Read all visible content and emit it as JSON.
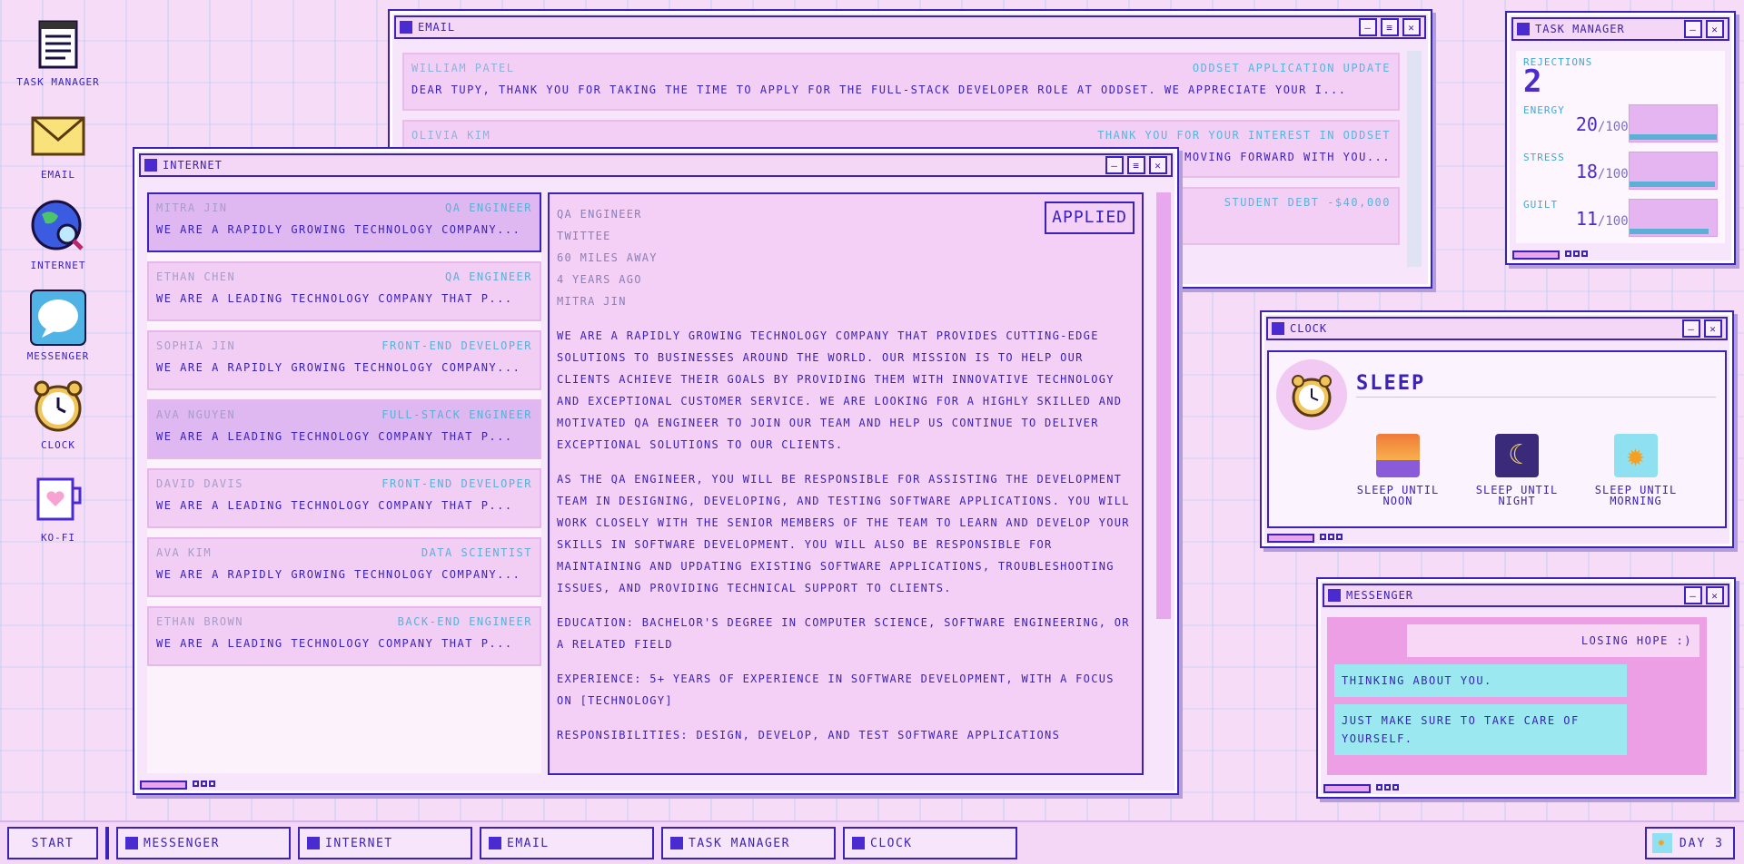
{
  "desktop": {
    "icons": [
      {
        "label": "Task Manager"
      },
      {
        "label": "Email"
      },
      {
        "label": "Internet"
      },
      {
        "label": "Messenger"
      },
      {
        "label": "Clock"
      },
      {
        "label": "Ko-fi"
      }
    ]
  },
  "email_window": {
    "title": "Email",
    "emails": [
      {
        "sender": "William Patel",
        "subject": "Oddset application update",
        "preview": "Dear Tupy, Thank you for taking the time to apply for the Full-Stack Developer role at Oddset. We appreciate your i..."
      },
      {
        "sender": "Olivia Kim",
        "subject": "Thank you for your interest in Oddset",
        "preview": "... moving forward with you..."
      },
      {
        "sender": "",
        "subject": "Student debt -$40,000",
        "preview": ""
      }
    ]
  },
  "internet_window": {
    "title": "Internet",
    "jobs": [
      {
        "name": "Mitra Jin",
        "role": "QA Engineer",
        "desc": "We are a rapidly growing technology company..."
      },
      {
        "name": "Ethan Chen",
        "role": "QA Engineer",
        "desc": "We are a leading technology company that p..."
      },
      {
        "name": "Sophia Jin",
        "role": "Front-End Developer",
        "desc": "We are a rapidly growing technology company..."
      },
      {
        "name": "Ava Nguyen",
        "role": "Full-Stack Engineer",
        "desc": "We are a leading technology company that p..."
      },
      {
        "name": "David Davis",
        "role": "Front-End Developer",
        "desc": "We are a leading technology company that p..."
      },
      {
        "name": "Ava Kim",
        "role": "Data Scientist",
        "desc": "We are a rapidly growing technology company..."
      },
      {
        "name": "Ethan Brown",
        "role": "Back-End Engineer",
        "desc": "We are a leading technology company that p..."
      }
    ],
    "detail": {
      "status": "Applied",
      "role": "QA Engineer",
      "company": "Twittee",
      "distance": "60 miles away",
      "posted": "4 years ago",
      "poster": "Mitra Jin",
      "p1": "We are a rapidly growing technology company that provides cutting-edge solutions to businesses around the world. Our mission is to help our clients achieve their goals by providing them with innovative technology and exceptional customer service. We are looking for a highly skilled and motivated QA Engineer to join our team and help us continue to deliver exceptional solutions to our clients.",
      "p2": "As the QA Engineer, you will be responsible for assisting the development team in designing, developing, and testing software applications. You will work closely with the senior members of the team to learn and develop your skills in software development. You will also be responsible for maintaining and updating existing software applications, troubleshooting issues, and providing technical support to clients.",
      "p3": "Education: Bachelor's degree in Computer Science, Software Engineering, or a related field",
      "p4": "Experience: 5+ years of experience in software development, with a focus on [technology]",
      "p5": "Responsibilities: Design, develop, and test software applications"
    }
  },
  "task_manager": {
    "title": "Task Manager",
    "rejections_label": "Rejections",
    "rejections": "2",
    "stats": [
      {
        "label": "Energy",
        "value": "20",
        "max": "/100",
        "fraction": 0.2
      },
      {
        "label": "Stress",
        "value": "18",
        "max": "/100",
        "fraction": 0.18
      },
      {
        "label": "Guilt",
        "value": "11",
        "max": "/100",
        "fraction": 0.11
      }
    ]
  },
  "clock_window": {
    "title": "Clock",
    "heading": "Sleep",
    "options": [
      {
        "label": "Sleep until noon"
      },
      {
        "label": "Sleep until night"
      },
      {
        "label": "Sleep until morning"
      }
    ]
  },
  "messenger_window": {
    "title": "Messenger",
    "messages": [
      {
        "text": "Losing hope :)"
      },
      {
        "text": "Thinking about you."
      },
      {
        "text": "Just make sure to take care of yourself."
      }
    ]
  },
  "taskbar": {
    "start": "Start",
    "items": [
      {
        "label": "Messenger"
      },
      {
        "label": "Internet"
      },
      {
        "label": "Email"
      },
      {
        "label": "Task Manager"
      },
      {
        "label": "Clock"
      }
    ],
    "day": "Day 3"
  }
}
